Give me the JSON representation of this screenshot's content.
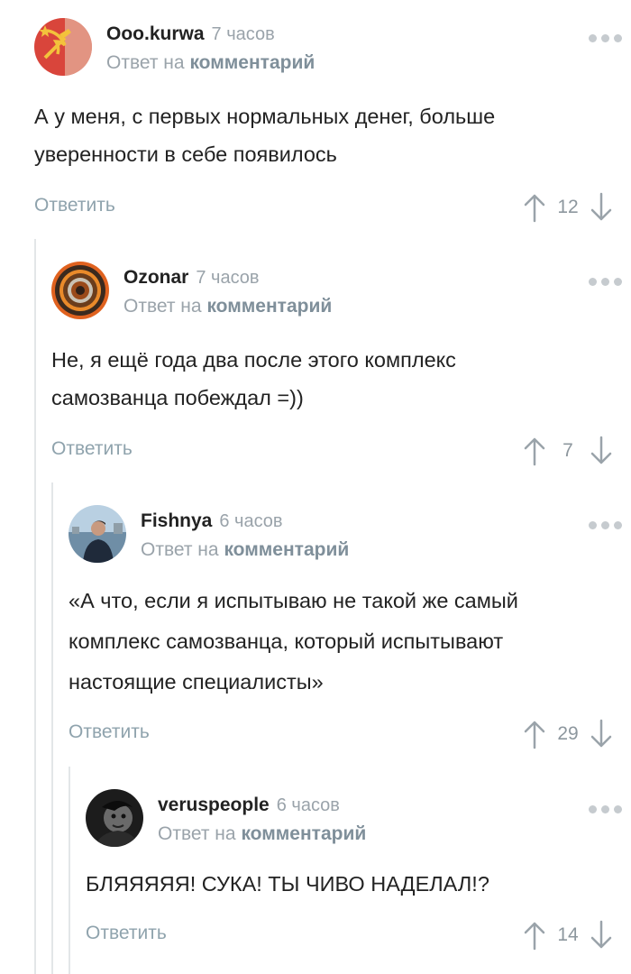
{
  "reply_label": "Ответить",
  "reply_to_prefix": "Ответ на",
  "reply_to_link": "комментарий",
  "comments": [
    {
      "author": "Ooo.kurwa",
      "time": "7 часов",
      "avatar_icon": "hammer-sickle-avatar",
      "text": [
        "А у меня, с первых нормальных денег, больше",
        "уверенности в себе появилось"
      ],
      "score": "12"
    },
    {
      "author": "Ozonar",
      "time": "7 часов",
      "avatar_icon": "ornament-avatar",
      "text": [
        "Не, я ещё года два после этого комплекс",
        "самозванца побеждал =))"
      ],
      "score": "7"
    },
    {
      "author": "Fishnya",
      "time": "6 часов",
      "avatar_icon": "person-photo-avatar",
      "text": [
        "«А что, если я испытываю не такой же самый",
        "комплекс самозванца, который испытывают",
        "настоящие специалисты»"
      ],
      "score": "29"
    },
    {
      "author": "veruspeople",
      "time": "6 часов",
      "avatar_icon": "dark-portrait-avatar",
      "text": [
        "БЛЯЯЯЯЯ! СУКА! ТЫ ЧИВО НАДЕЛАЛ!?"
      ],
      "score": "14"
    }
  ],
  "colors": {
    "text": "#222222",
    "muted": "#9aa3aa",
    "reply": "#8fa3ad",
    "thread_line": "#e3e6e8"
  }
}
